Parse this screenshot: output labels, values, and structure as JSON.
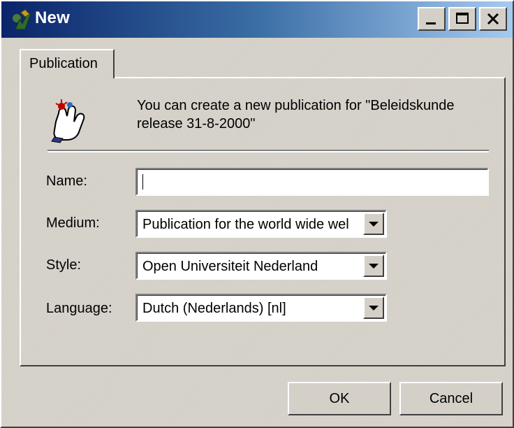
{
  "window": {
    "title": "New",
    "colors": {
      "title_gradient_left": "#0a246a",
      "title_gradient_right": "#a6caf0",
      "face": "#d4d0c8"
    }
  },
  "titlebar": {
    "icon": "app-icon",
    "buttons": {
      "minimize": "minimize-icon",
      "maximize": "maximize-icon",
      "close": "close-icon"
    }
  },
  "tabs": [
    {
      "label": "Publication"
    }
  ],
  "content": {
    "icon": "hand-pointer-icon",
    "message": "You can create a new publication for \"Beleidskunde release 31-8-2000\""
  },
  "fields": {
    "name": {
      "label": "Name:",
      "value": ""
    },
    "medium": {
      "label": "Medium:",
      "value": "Publication for the world wide wel"
    },
    "style": {
      "label": "Style:",
      "value": "Open Universiteit Nederland"
    },
    "language": {
      "label": "Language:",
      "value": "Dutch (Nederlands) [nl]"
    }
  },
  "buttons": {
    "ok": "OK",
    "cancel": "Cancel"
  }
}
